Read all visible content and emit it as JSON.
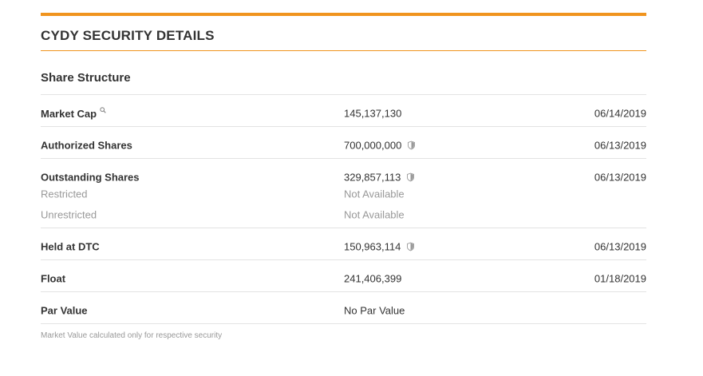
{
  "header": {
    "title": "CYDY SECURITY DETAILS"
  },
  "section": {
    "title": "Share Structure"
  },
  "rows": [
    {
      "label": "Market Cap",
      "value": "145,137,130",
      "date": "06/14/2019",
      "icon": "search-icon"
    },
    {
      "label": "Authorized Shares",
      "value": "700,000,000",
      "date": "06/13/2019",
      "icon": "shield-icon"
    },
    {
      "label": "Outstanding Shares",
      "value": "329,857,113",
      "date": "06/13/2019",
      "icon": "shield-icon",
      "sub": [
        {
          "label": "Restricted",
          "value": "Not Available"
        },
        {
          "label": "Unrestricted",
          "value": "Not Available"
        }
      ]
    },
    {
      "label": "Held at DTC",
      "value": "150,963,114",
      "date": "06/13/2019",
      "icon": "shield-icon"
    },
    {
      "label": "Float",
      "value": "241,406,399",
      "date": "01/18/2019"
    },
    {
      "label": "Par Value",
      "value": "No Par Value",
      "date": ""
    }
  ],
  "footnote": "Market Value calculated only for respective security",
  "colors": {
    "accent": "#f0941e",
    "text": "#333333",
    "muted": "#999999",
    "divider": "#e3e3e3"
  }
}
